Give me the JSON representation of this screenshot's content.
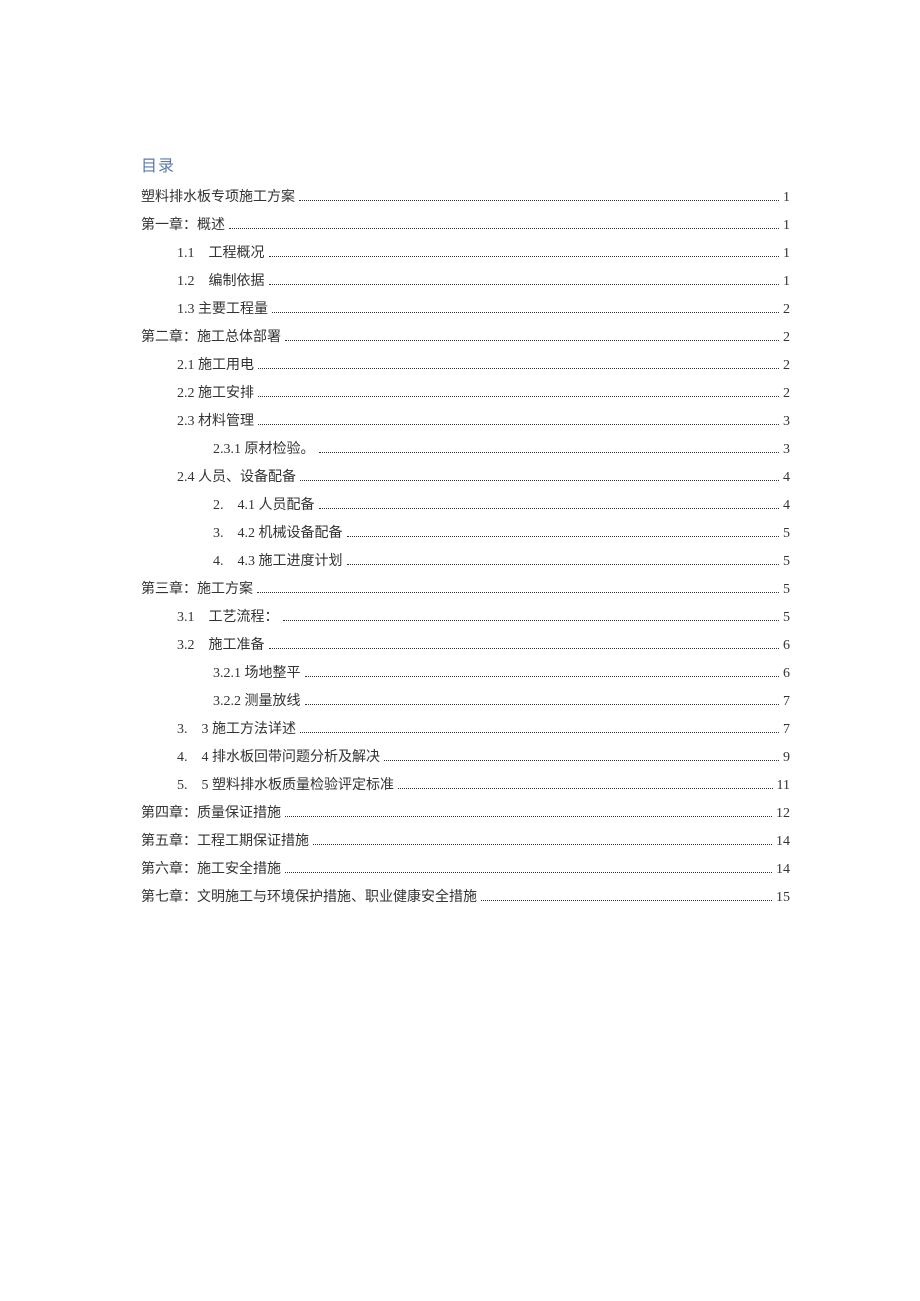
{
  "toc_title": "目录",
  "entries": [
    {
      "indent": 0,
      "label": "塑料排水板专项施工方案",
      "page": "1"
    },
    {
      "indent": 0,
      "label": "第一章：概述",
      "page": "1"
    },
    {
      "indent": 1,
      "label": "1.1　工程概况",
      "page": "1"
    },
    {
      "indent": 1,
      "label": "1.2　编制依据",
      "page": "1"
    },
    {
      "indent": 1,
      "label": "1.3 主要工程量",
      "page": "2"
    },
    {
      "indent": 0,
      "label": "第二章：施工总体部署",
      "page": "2"
    },
    {
      "indent": 1,
      "label": "2.1 施工用电",
      "page": "2"
    },
    {
      "indent": 1,
      "label": "2.2 施工安排",
      "page": "2"
    },
    {
      "indent": 1,
      "label": "2.3 材料管理",
      "page": "3"
    },
    {
      "indent": 2,
      "label": "2.3.1 原材检验。",
      "page": "3"
    },
    {
      "indent": 1,
      "label": "2.4 人员、设备配备",
      "page": "4"
    },
    {
      "indent": 2,
      "label": "2.　4.1 人员配备",
      "page": "4"
    },
    {
      "indent": 2,
      "label": "3.　4.2 机械设备配备",
      "page": "5"
    },
    {
      "indent": 2,
      "label": "4.　4.3 施工进度计划",
      "page": "5"
    },
    {
      "indent": 0,
      "label": "第三章：施工方案",
      "page": "5"
    },
    {
      "indent": 1,
      "label": "3.1　工艺流程：",
      "page": "5"
    },
    {
      "indent": 1,
      "label": "3.2　施工准备",
      "page": "6"
    },
    {
      "indent": 2,
      "label": "3.2.1 场地整平",
      "page": "6"
    },
    {
      "indent": 2,
      "label": "3.2.2 测量放线",
      "page": "7"
    },
    {
      "indent": 1,
      "label": "3.　3 施工方法详述",
      "page": "7"
    },
    {
      "indent": 1,
      "label": "4.　4 排水板回带问题分析及解决",
      "page": "9"
    },
    {
      "indent": 1,
      "label": "5.　5 塑料排水板质量检验评定标准",
      "page": "11"
    },
    {
      "indent": 0,
      "label": "第四章：质量保证措施",
      "page": "12"
    },
    {
      "indent": 0,
      "label": "第五章：工程工期保证措施",
      "page": "14"
    },
    {
      "indent": 0,
      "label": "第六章：施工安全措施",
      "page": "14"
    },
    {
      "indent": 0,
      "label": "第七章：文明施工与环境保护措施、职业健康安全措施",
      "page": "15"
    }
  ]
}
